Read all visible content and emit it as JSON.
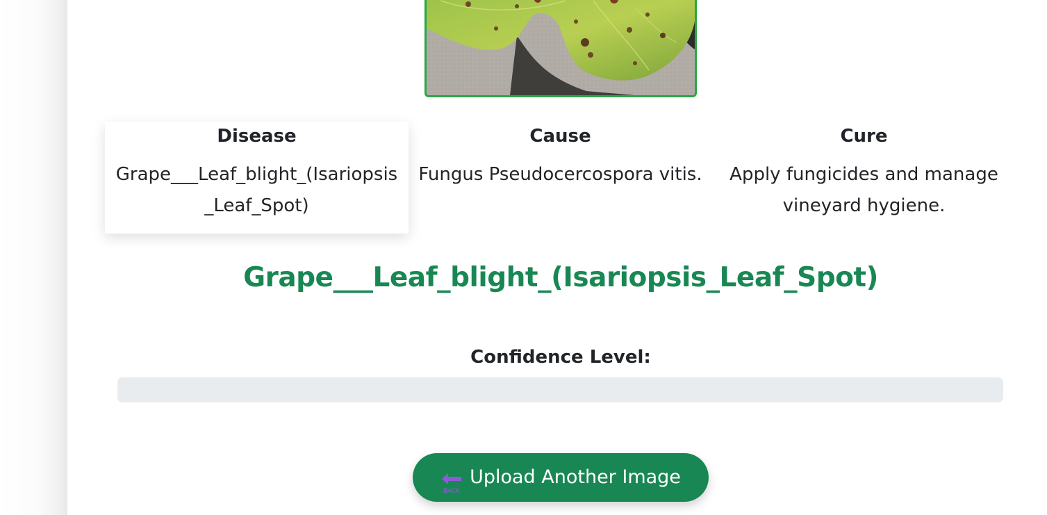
{
  "image": {
    "alt": "leaf"
  },
  "cards": [
    {
      "heading": "Disease",
      "text": "Grape___Leaf_blight_(Isariopsis_Leaf_Spot)"
    },
    {
      "heading": "Cause",
      "text": "Fungus Pseudocercospora vitis."
    },
    {
      "heading": "Cure",
      "text": "Apply fungicides and manage vineyard hygiene."
    }
  ],
  "result_title": "Grape___Leaf_blight_(Isariopsis_Leaf_Spot)",
  "confidence": {
    "label": "Confidence Level:",
    "value_fraction": 0
  },
  "upload_button": {
    "label": "Upload Another Image",
    "icon": "back-arrow-icon",
    "icon_text": "BACK"
  },
  "colors": {
    "accent": "#198754",
    "image_border": "#28a745",
    "progress_track": "#e9ecef",
    "back_icon": "#8e5bd6"
  }
}
